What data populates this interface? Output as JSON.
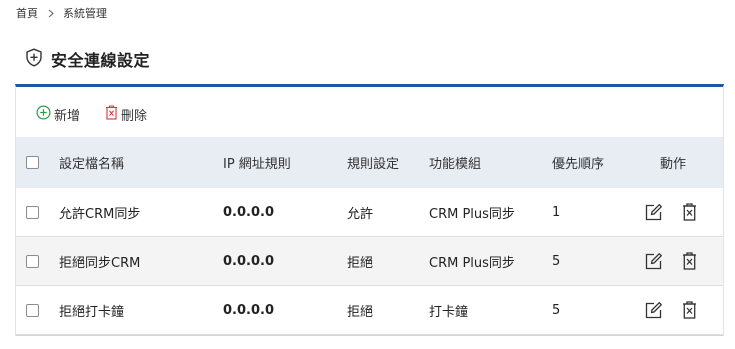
{
  "breadcrumb": {
    "home": "首頁",
    "current": "系統管理"
  },
  "page": {
    "title": "安全連線設定"
  },
  "toolbar": {
    "add_label": "新增",
    "delete_label": "刪除"
  },
  "table": {
    "columns": {
      "name": "設定檔名稱",
      "ip": "IP 網址規則",
      "rule": "規則設定",
      "module": "功能模組",
      "priority": "優先順序",
      "action": "動作"
    },
    "rows": [
      {
        "name": "允許CRM同步",
        "ip": "0.0.0.0",
        "rule": "允許",
        "module": "CRM Plus同步",
        "priority": "1"
      },
      {
        "name": "拒絕同步CRM",
        "ip": "0.0.0.0",
        "rule": "拒絕",
        "module": "CRM Plus同步",
        "priority": "5"
      },
      {
        "name": "拒絕打卡鐘",
        "ip": "0.0.0.0",
        "rule": "拒絕",
        "module": "打卡鐘",
        "priority": "5"
      }
    ]
  },
  "icons": {
    "breadcrumb_separator": "chevron-right-icon",
    "title": "shield-plus-icon",
    "add": "plus-circle-icon",
    "delete": "trash-x-icon",
    "row_edit": "edit-icon",
    "row_delete": "trash-x-icon"
  },
  "colors": {
    "accent": "#2256a6",
    "add_green": "#2e9b47",
    "delete_red": "#d9363e",
    "header_bg": "#e8ecf3"
  }
}
